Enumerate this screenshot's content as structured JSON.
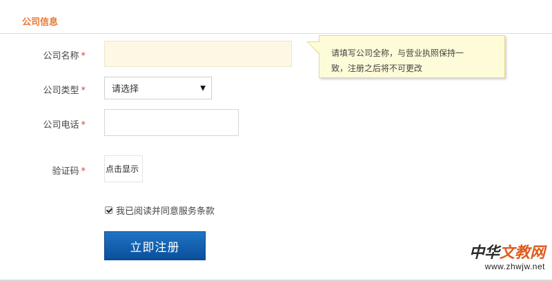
{
  "section": {
    "title": "公司信息"
  },
  "form": {
    "required_mark": "*",
    "company_name": {
      "label": "公司名称",
      "value": ""
    },
    "company_type": {
      "label": "公司类型",
      "selected": "请选择",
      "arrow": "▼"
    },
    "company_phone": {
      "label": "公司电话",
      "value": ""
    },
    "captcha": {
      "label": "验证码",
      "button": "点击显示"
    },
    "agree": {
      "text": "我已阅读并同意服务条款",
      "checked": true
    },
    "submit": "立即注册"
  },
  "tooltip": {
    "line1": "请填写公司全称，与营业执照保持一",
    "line2": "致，注册之后将不可更改"
  },
  "watermark": {
    "logo_a": "中华",
    "logo_b": "文教网",
    "url": "www.zhwjw.net"
  },
  "colors": {
    "accent": "#e8772e",
    "required": "#e03c3c",
    "button": "#0f5fae",
    "tooltip_bg": "#fefbd8"
  }
}
